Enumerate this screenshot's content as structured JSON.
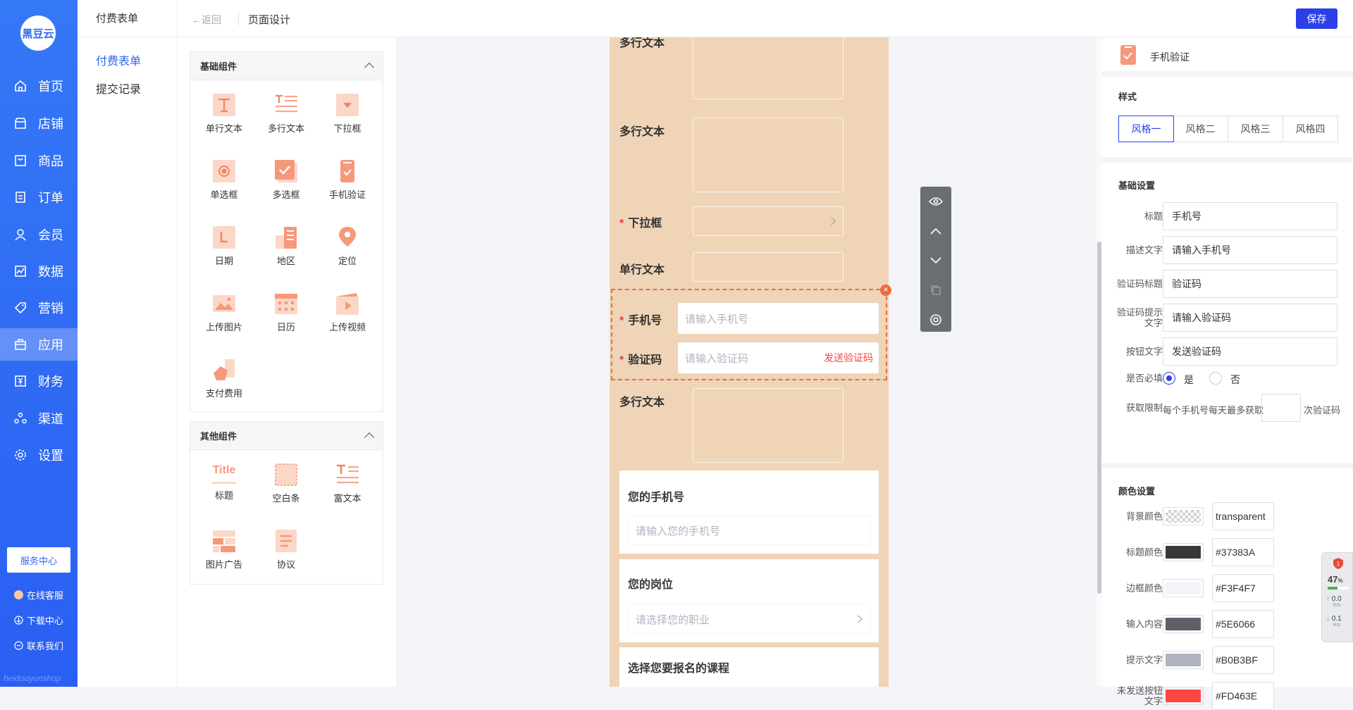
{
  "nav": {
    "logo": "黑豆云",
    "items": [
      {
        "label": "首页",
        "icon": "home-icon"
      },
      {
        "label": "店铺",
        "icon": "store-icon"
      },
      {
        "label": "商品",
        "icon": "goods-icon"
      },
      {
        "label": "订单",
        "icon": "order-icon"
      },
      {
        "label": "会员",
        "icon": "member-icon"
      },
      {
        "label": "数据",
        "icon": "chart-icon"
      },
      {
        "label": "营销",
        "icon": "tag-icon"
      },
      {
        "label": "应用",
        "icon": "app-icon"
      },
      {
        "label": "财务",
        "icon": "finance-icon"
      },
      {
        "label": "渠道",
        "icon": "channel-icon"
      },
      {
        "label": "设置",
        "icon": "gear-icon"
      }
    ],
    "service_center": "服务中心",
    "online_service": "在线客服",
    "download_center": "下载中心",
    "contact_us": "联系我们",
    "footer": "heidouyunshop"
  },
  "subnav": {
    "title": "付费表单",
    "links": [
      "付费表单",
      "提交记录"
    ]
  },
  "topbar": {
    "back": "返回",
    "title": "页面设计",
    "save": "保存"
  },
  "palette": {
    "basic": {
      "title": "基础组件",
      "items": [
        "单行文本",
        "多行文本",
        "下拉框",
        "单选框",
        "多选框",
        "手机验证",
        "日期",
        "地区",
        "定位",
        "上传图片",
        "日历",
        "上传视频",
        "支付费用"
      ]
    },
    "other": {
      "title": "其他组件",
      "items": [
        "标题",
        "空白条",
        "富文本",
        "图片广告",
        "协议"
      ],
      "title_icon_text": "Title"
    }
  },
  "canvas": {
    "fields": {
      "multi1": "多行文本",
      "multi2": "多行文本",
      "select": "下拉框",
      "single": "单行文本",
      "multi3": "多行文本"
    },
    "phone": {
      "label": "手机号",
      "placeholder": "请输入手机号",
      "code_label": "验证码",
      "code_placeholder": "请输入验证码",
      "send_button": "发送验证码"
    },
    "cards": [
      {
        "title": "您的手机号",
        "placeholder": "请输入您的手机号"
      },
      {
        "title": "您的岗位",
        "placeholder": "请选择您的职业"
      },
      {
        "title": "选择您要报名的课程"
      }
    ],
    "close": "×"
  },
  "settings": {
    "header": "手机验证",
    "style": {
      "title": "样式",
      "tabs": [
        "风格一",
        "风格二",
        "风格三",
        "风格四"
      ]
    },
    "basic": {
      "title": "基础设置",
      "rows": [
        {
          "label": "标题",
          "value": "手机号"
        },
        {
          "label": "描述文字",
          "value": "请输入手机号"
        },
        {
          "label": "验证码标题",
          "value": "验证码"
        },
        {
          "label": "验证码提示文字",
          "value": "请输入验证码"
        },
        {
          "label": "按钮文字",
          "value": "发送验证码"
        }
      ],
      "required_label": "是否必填",
      "yes": "是",
      "no": "否",
      "limit_label": "获取限制",
      "limit_prefix": "每个手机号每天最多获取",
      "limit_suffix": "次验证码"
    },
    "colors": {
      "title": "颜色设置",
      "rows": [
        {
          "label": "背景颜色",
          "value": "transparent",
          "swatch": "checker"
        },
        {
          "label": "标题颜色",
          "value": "#37383A",
          "swatch": "#37383A"
        },
        {
          "label": "边框颜色",
          "value": "#F3F4F7",
          "swatch": "#F3F4F7"
        },
        {
          "label": "输入内容",
          "value": "#5E6066",
          "swatch": "#5E6066"
        },
        {
          "label": "提示文字",
          "value": "#B0B3BF",
          "swatch": "#B0B3BF"
        },
        {
          "label": "未发送按钮文字",
          "value": "#FD463E",
          "swatch": "#FD463E"
        }
      ]
    }
  },
  "netspeed": {
    "percent": "47",
    "unit": "%",
    "up": "0.0",
    "down": "0.1",
    "rate_unit": "K/s"
  }
}
